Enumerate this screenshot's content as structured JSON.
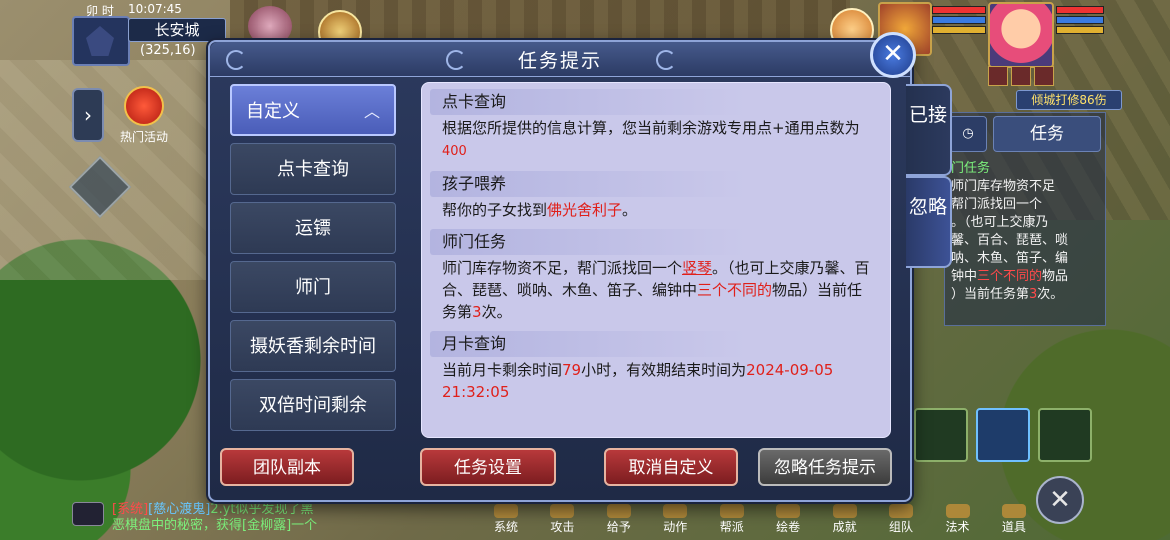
{
  "hud": {
    "hour_label": "卯 时",
    "clock": "10:07:45",
    "city": "长安城",
    "coords": "(325,16)",
    "hot_event_label": "热门活动",
    "player_title": "倾城打修86伤"
  },
  "dialog": {
    "title": "任务提示",
    "close_symbol": "✕",
    "side_tabs": {
      "accepted": "已接",
      "ignore": "忽略"
    },
    "categories": [
      {
        "label": "自定义",
        "active": true
      },
      {
        "label": "点卡查询"
      },
      {
        "label": "运镖"
      },
      {
        "label": "师门"
      },
      {
        "label": "摄妖香剩余时间"
      },
      {
        "label": "双倍时间剩余"
      }
    ],
    "category_chevron": "︿",
    "sections": {
      "card": {
        "title": "点卡查询",
        "text1": "根据您所提供的信息计算，您当前剩余游戏专用点+通用点数为",
        "value": "400"
      },
      "child": {
        "title": "孩子喂养",
        "text1": "帮你的子女找到",
        "target": "佛光舍利子",
        "text2": "。"
      },
      "sect": {
        "title": "师门任务",
        "text1": "师门库存物资不足，帮门派找回一个",
        "item": "竖琴",
        "text2": "。（也可上交康乃馨、百合、琵琶、唢呐、木鱼、笛子、编钟中",
        "hint": "三个不同的",
        "text3": "物品）当前任务第",
        "count": "3",
        "text4": "次。"
      },
      "month": {
        "title": "月卡查询",
        "text1": "当前月卡剩余时间",
        "hours": "79",
        "text2": "小时，有效期结束时间为",
        "expire": "2024-09-05 21:32:05"
      }
    },
    "buttons": {
      "team_dungeon": "团队副本",
      "task_settings": "任务设置",
      "cancel_custom": "取消自定义",
      "ignore_hint": "忽略任务提示"
    }
  },
  "tracker": {
    "task_tab": "任务",
    "title": "门任务",
    "line1": "师门库存物资不足",
    "line2": "帮门派找回一个",
    "line3": "。（也可上交康乃",
    "line4": "馨、百合、琵琶、唢",
    "line5": "呐、木鱼、笛子、编",
    "line6a": "钟中",
    "line6b": "三个不同的",
    "line6c": "物品",
    "line7": "）当前任务第",
    "line7b": "次。"
  },
  "menu": [
    "系统",
    "攻击",
    "给予",
    "动作",
    "帮派",
    "绘卷",
    "成就",
    "组队",
    "法术",
    "道具"
  ],
  "chat": {
    "sys": "[系统]",
    "name": "[慈心渡鬼]",
    "text1": "2.yt似乎发现了黑",
    "text2": "恶棋盘中的秘密，获得",
    "item": "[金柳露]",
    "text3": "一个"
  },
  "colors": {
    "accent_red": "#e0201a",
    "panel": "#c9c8ea",
    "frame": "#8ea4d8"
  }
}
